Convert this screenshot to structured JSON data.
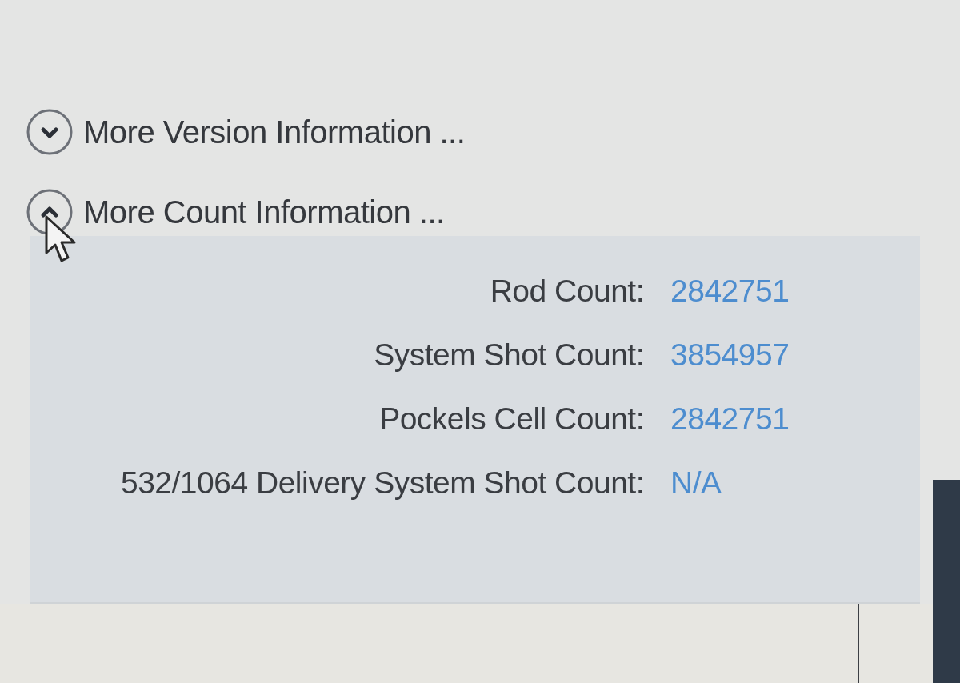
{
  "sections": [
    {
      "title": "More Version Information ...",
      "expanded": false
    },
    {
      "title": "More Count Information ...",
      "expanded": true,
      "fields": [
        {
          "label": "Rod Count:",
          "value": "2842751"
        },
        {
          "label": "System Shot Count:",
          "value": "3854957"
        },
        {
          "label": "Pockels Cell Count:",
          "value": "2842751"
        },
        {
          "label": "532/1064 Delivery System Shot Count:",
          "value": "N/A"
        }
      ]
    }
  ]
}
